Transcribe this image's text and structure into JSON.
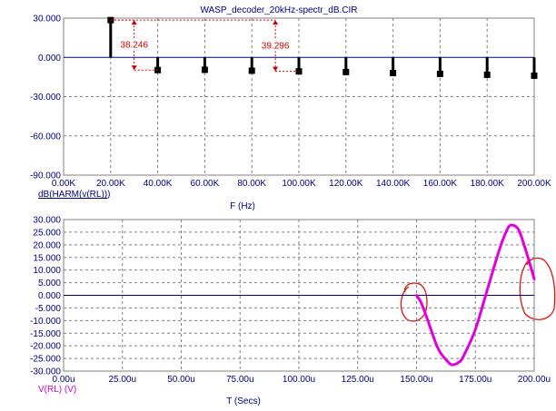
{
  "chart_data": [
    {
      "type": "bar",
      "title": "WASP_decoder_20kHz-spectr_dB.CIR",
      "xlabel": "F (Hz)",
      "ylabel": "dB(HARM(v(RL)))",
      "xlim": [
        0,
        200000
      ],
      "ylim": [
        -90,
        30
      ],
      "xticks": [
        0,
        20000,
        40000,
        60000,
        80000,
        100000,
        120000,
        140000,
        160000,
        180000,
        200000
      ],
      "xtick_labels": [
        "0.00K",
        "20.00K",
        "40.00K",
        "60.00K",
        "80.00K",
        "100.00K",
        "120.00K",
        "140.00K",
        "160.00K",
        "180.00K",
        "200.00K"
      ],
      "yticks": [
        30,
        0,
        -30,
        -60,
        -90
      ],
      "ytick_labels": [
        "30.000",
        "0.000",
        "-30.000",
        "-60.000",
        "-90.000"
      ],
      "grid": true,
      "x": [
        20000,
        40000,
        60000,
        80000,
        100000,
        120000,
        140000,
        160000,
        180000,
        200000
      ],
      "values": [
        28.5,
        -9.7,
        -9.5,
        -10.2,
        -10.7,
        -11.2,
        -12.0,
        -12.6,
        -13.3,
        -14.0
      ],
      "annotations": [
        {
          "text": "38.246",
          "x": 30000,
          "y_top": 28.5,
          "y_bottom": -9.7
        },
        {
          "text": "39.296",
          "x": 90000,
          "y_top": 28.5,
          "y_bottom": -10.7
        }
      ]
    },
    {
      "type": "line",
      "xlabel": "T (Secs)",
      "ylabel": "V(RL) (V)",
      "xlim": [
        0,
        0.0002
      ],
      "ylim": [
        -30,
        30
      ],
      "xticks": [
        0,
        2.5e-05,
        5e-05,
        7.5e-05,
        0.0001,
        0.000125,
        0.00015,
        0.000175,
        0.0002
      ],
      "xtick_labels": [
        "0.00u",
        "25.00u",
        "50.00u",
        "75.00u",
        "100.00u",
        "125.00u",
        "150.00u",
        "175.00u",
        "200.00u"
      ],
      "yticks": [
        30,
        25,
        20,
        15,
        10,
        5,
        0,
        -5,
        -10,
        -15,
        -20,
        -25,
        -30
      ],
      "ytick_labels": [
        "30.000",
        "25.000",
        "20.000",
        "15.000",
        "10.000",
        "5.000",
        "0.000",
        "-5.000",
        "-10.000",
        "-15.000",
        "-20.000",
        "-25.000",
        "-30.000"
      ],
      "grid": true,
      "series": [
        {
          "name": "V(RL)",
          "color": "#e000e0",
          "x": [
            0.00015,
            0.000152,
            0.000155,
            0.000158,
            0.00016,
            0.000163,
            0.000165,
            0.000168,
            0.00017,
            0.000175,
            0.00018,
            0.000185,
            0.000188,
            0.00019,
            0.000193,
            0.000195,
            0.000198,
            0.0002
          ],
          "y": [
            0.0,
            -3.0,
            -10.5,
            -18.5,
            -22.5,
            -26.0,
            -27.5,
            -26.5,
            -24.0,
            -13.5,
            2.0,
            17.5,
            25.0,
            27.8,
            26.5,
            22.0,
            13.0,
            6.5
          ]
        }
      ]
    }
  ]
}
